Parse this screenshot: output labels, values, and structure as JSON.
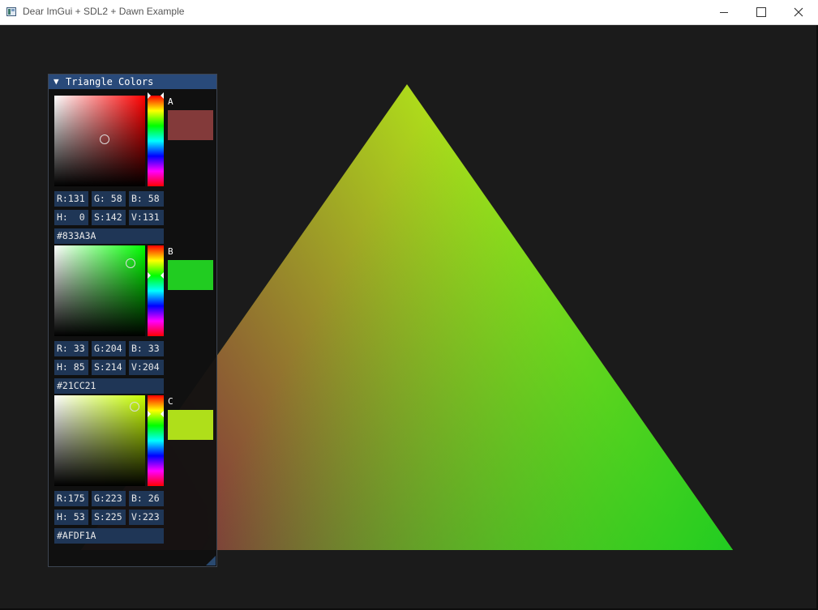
{
  "window": {
    "title": "Dear ImGui + SDL2 + Dawn Example",
    "icon": "app-window-icon",
    "controls": [
      "minimize-icon",
      "maximize-icon",
      "close-icon"
    ]
  },
  "scene": {
    "background": "#1b1b1b",
    "triangle_vertex_colors": [
      "#833A3A",
      "#21CC21",
      "#AFDF1A"
    ]
  },
  "panel": {
    "title": "Triangle Colors",
    "collapse_icon": "▼",
    "title_bg": "#294a7a",
    "pickers": [
      {
        "label": "A",
        "hex": "#833A3A",
        "rgb": {
          "r": "R:131",
          "g": "G: 58",
          "b": "B: 58"
        },
        "hsv": {
          "h": "H:  0",
          "s": "S:142",
          "v": "V:131"
        },
        "swatch": "#833A3A",
        "hue_color": "#ff0000",
        "hue_fraction": 0.0,
        "saturation_fraction": 0.557,
        "value_fraction": 0.514
      },
      {
        "label": "B",
        "hex": "#21CC21",
        "rgb": {
          "r": "R: 33",
          "g": "G:204",
          "b": "B: 33"
        },
        "hsv": {
          "h": "H: 85",
          "s": "S:214",
          "v": "V:204"
        },
        "swatch": "#21CC21",
        "hue_color": "#00ff00",
        "hue_fraction": 0.333,
        "saturation_fraction": 0.839,
        "value_fraction": 0.8
      },
      {
        "label": "C",
        "hex": "#AFDF1A",
        "rgb": {
          "r": "R:175",
          "g": "G:223",
          "b": "B: 26"
        },
        "hsv": {
          "h": "H: 53",
          "s": "S:225",
          "v": "V:223"
        },
        "swatch": "#AFDF1A",
        "hue_color": "#c8ff00",
        "hue_fraction": 0.208,
        "saturation_fraction": 0.882,
        "value_fraction": 0.875
      }
    ]
  }
}
